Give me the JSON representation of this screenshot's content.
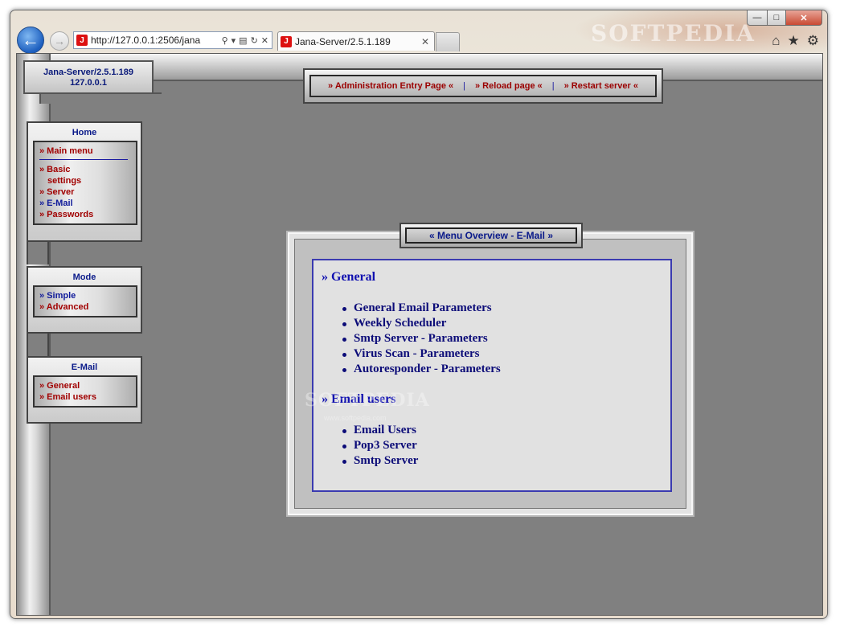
{
  "browser": {
    "address": "http://127.0.0.1:2506/jana",
    "tab_title": "Jana-Server/2.5.1.189",
    "tab_close": "✕",
    "favicon_label": "J",
    "watermark": "SOFTPEDIA"
  },
  "window_controls": {
    "minimize": "—",
    "maximize": "□",
    "close": "✕"
  },
  "server": {
    "name": "Jana-Server/2.5.1.189",
    "ip": "127.0.0.1"
  },
  "top_nav": [
    {
      "label": "» Administration Entry Page «"
    },
    {
      "label": "» Reload page «"
    },
    {
      "label": "» Restart server «"
    }
  ],
  "sidebar": {
    "home": {
      "title": "Home",
      "main_menu": "» Main menu",
      "basic": "» Basic",
      "basic_cont": "settings",
      "server": "» Server",
      "email": "» E-Mail",
      "passwords": "» Passwords"
    },
    "mode": {
      "title": "Mode",
      "simple": "» Simple",
      "advanced": "» Advanced"
    },
    "email": {
      "title": "E-Mail",
      "general": "» General",
      "users": "» Email users"
    }
  },
  "content": {
    "tab_title": "« Menu Overview - E-Mail »",
    "sections": [
      {
        "heading": "» General",
        "items": [
          "General Email Parameters",
          "Weekly Scheduler",
          "Smtp Server - Parameters",
          "Virus Scan - Parameters",
          "Autoresponder - Parameters"
        ]
      },
      {
        "heading": "» Email users",
        "items": [
          "Email Users",
          "Pop3 Server",
          "Smtp Server"
        ]
      }
    ]
  },
  "watermarks": {
    "center": "SOFTPEDIA",
    "url": "www.softpedia.com"
  }
}
